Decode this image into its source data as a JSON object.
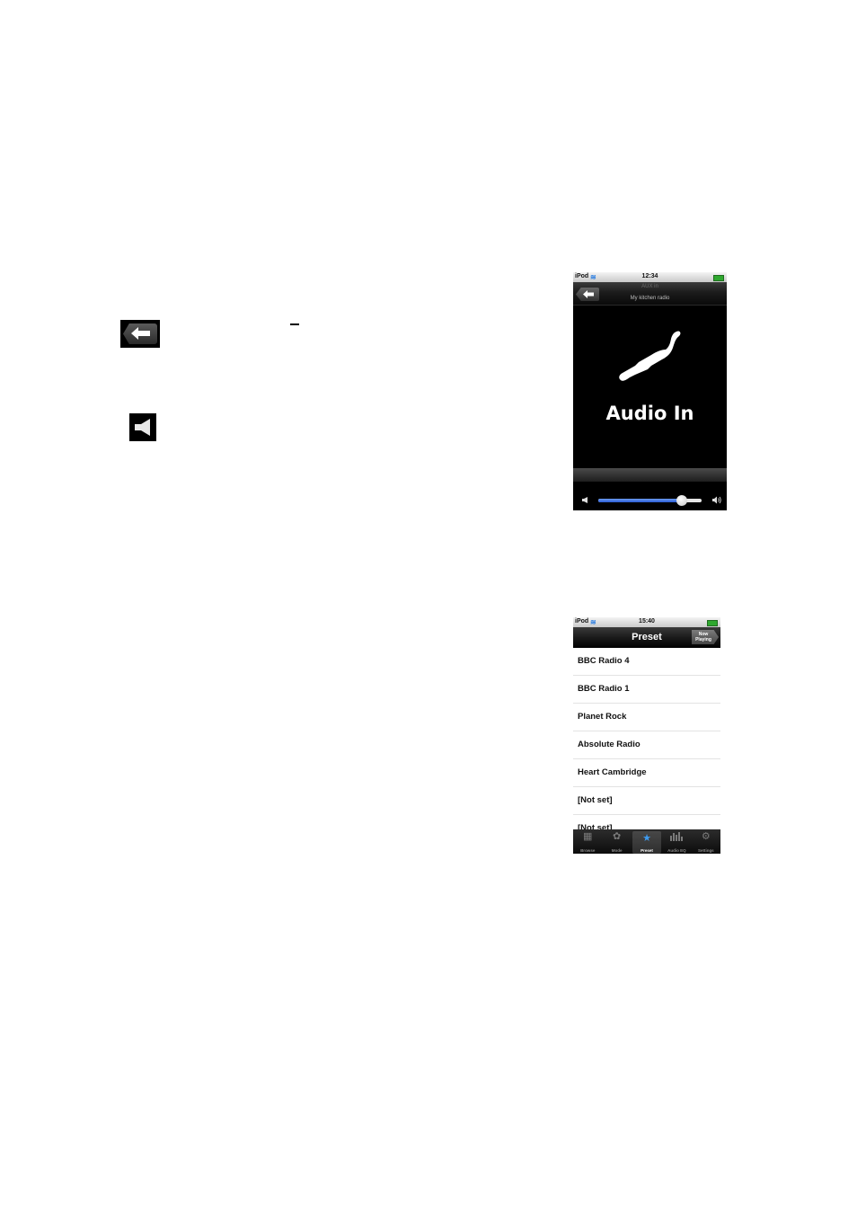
{
  "document": {
    "icons": [
      {
        "name": "back-icon"
      },
      {
        "name": "speaker-icon"
      }
    ]
  },
  "audio_in_screen": {
    "status_bar": {
      "carrier": "iPod",
      "time": "12:34"
    },
    "nav": {
      "subtitle": "AUX in",
      "device_name": "My kitchen radio"
    },
    "title": "Audio In",
    "volume": {
      "level_percent": 81
    },
    "colors": {
      "slider_fill": "#2a5cd6",
      "battery": "#2fa82f"
    }
  },
  "preset_screen": {
    "status_bar": {
      "carrier": "iPod",
      "time": "15:40"
    },
    "nav": {
      "title": "Preset",
      "now_playing_line1": "Now",
      "now_playing_line2": "Playing"
    },
    "presets": [
      {
        "label": "BBC Radio 4"
      },
      {
        "label": "BBC Radio 1"
      },
      {
        "label": "Planet Rock"
      },
      {
        "label": "Absolute Radio"
      },
      {
        "label": "Heart Cambridge"
      },
      {
        "label": "[Not set]"
      },
      {
        "label": "[Not set]"
      }
    ],
    "tabs": [
      {
        "label": "Browse",
        "icon": "browse-icon",
        "glyph": "▦",
        "active": false
      },
      {
        "label": "Mode",
        "icon": "mode-icon",
        "glyph": "✿",
        "active": false
      },
      {
        "label": "Preset",
        "icon": "star-icon",
        "glyph": "★",
        "active": true
      },
      {
        "label": "Audio EQ",
        "icon": "equalizer-icon",
        "glyph": "▮",
        "active": false
      },
      {
        "label": "Settings",
        "icon": "gear-icon",
        "glyph": "⚙",
        "active": false
      }
    ],
    "colors": {
      "active_tab": "#3d9bf0"
    }
  }
}
